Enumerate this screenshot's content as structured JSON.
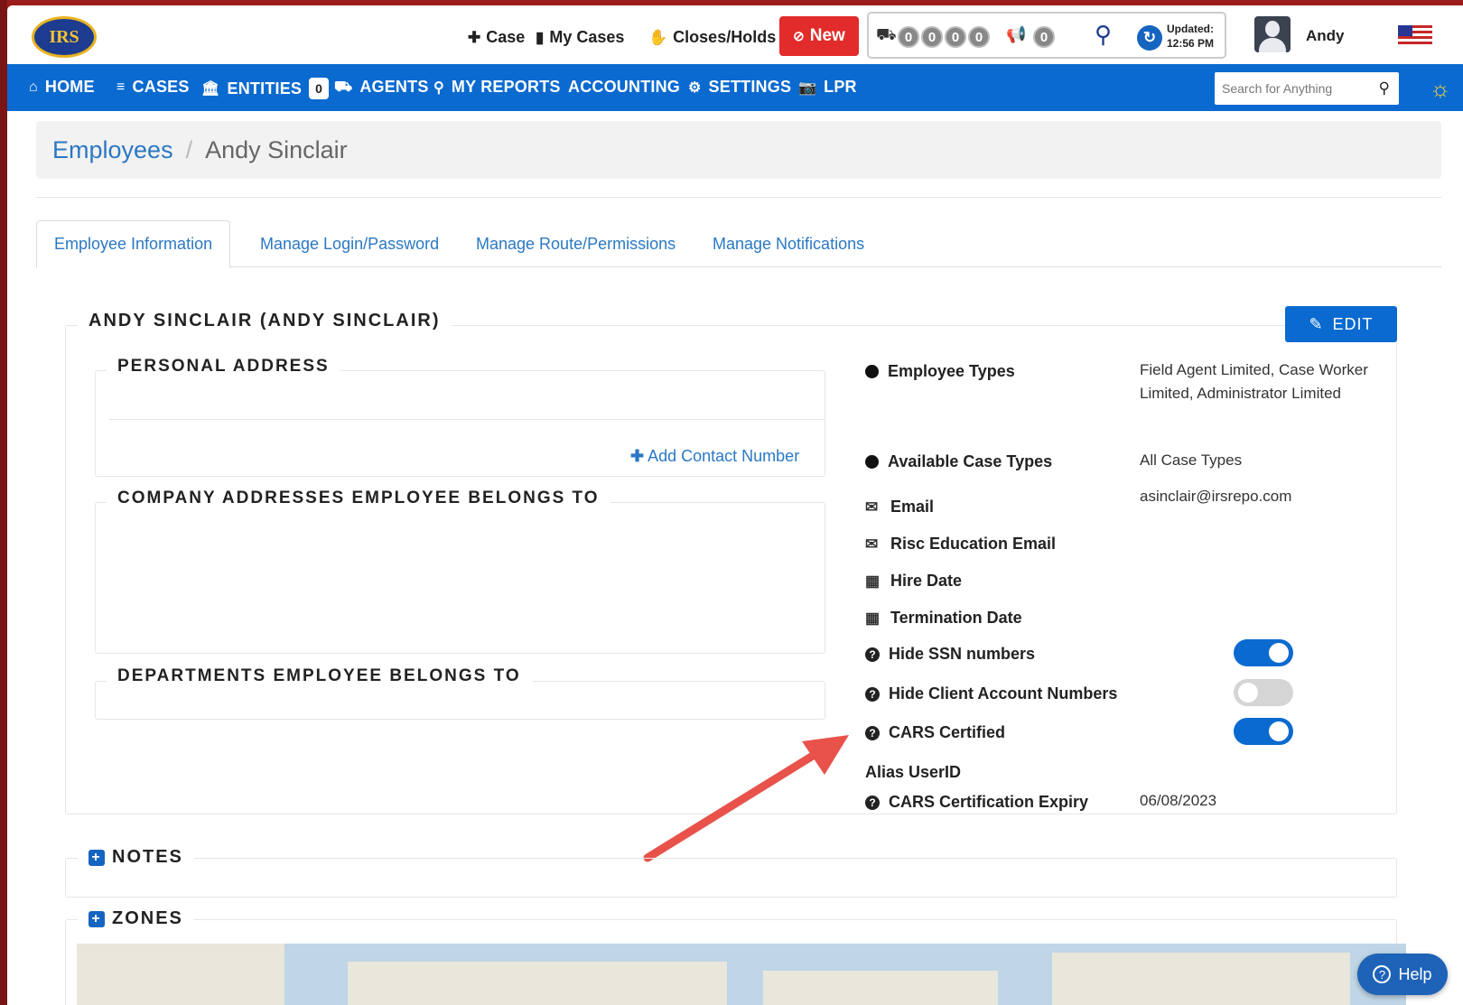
{
  "header": {
    "logo_text": "IRS",
    "case_label": "Case",
    "my_cases_label": "My Cases",
    "closes_holds_label": "Closes/Holds",
    "new_label": "New",
    "counters": [
      "0",
      "0",
      "0",
      "0"
    ],
    "megaphone_count": "0",
    "updated_label": "Updated:",
    "updated_time": "12:56 PM",
    "username": "Andy"
  },
  "nav": {
    "home": "HOME",
    "cases": "CASES",
    "entities": "ENTITIES",
    "entities_badge": "0",
    "agents": "AGENTS",
    "my_reports": "MY REPORTS",
    "accounting": "ACCOUNTING",
    "settings": "SETTINGS",
    "lpr": "LPR",
    "search_placeholder": "Search for Anything"
  },
  "breadcrumb": {
    "parent": "Employees",
    "separator": "/",
    "current": "Andy Sinclair"
  },
  "tabs": [
    {
      "label": "Employee Information",
      "active": true
    },
    {
      "label": "Manage Login/Password",
      "active": false
    },
    {
      "label": "Manage Route/Permissions",
      "active": false
    },
    {
      "label": "Manage Notifications",
      "active": false
    }
  ],
  "employee": {
    "title": "ANDY SINCLAIR (ANDY SINCLAIR)",
    "edit_label": "EDIT",
    "personal_address_title": "PERSONAL ADDRESS",
    "add_contact_label": "Add Contact Number",
    "company_addresses_title": "COMPANY ADDRESSES EMPLOYEE BELONGS TO",
    "departments_title": "DEPARTMENTS EMPLOYEE BELONGS TO"
  },
  "info": {
    "employee_types_label": "Employee Types",
    "employee_types_value": "Field Agent Limited, Case Worker Limited, Administrator Limited",
    "available_case_types_label": "Available Case Types",
    "available_case_types_value": "All Case Types",
    "email_label": "Email",
    "email_value": "asinclair@irsrepo.com",
    "risc_email_label": "Risc Education Email",
    "hire_date_label": "Hire Date",
    "termination_date_label": "Termination Date",
    "hide_ssn_label": "Hide SSN numbers",
    "hide_ssn_on": true,
    "hide_client_label": "Hide Client Account Numbers",
    "hide_client_on": false,
    "cars_certified_label": "CARS Certified",
    "cars_certified_on": true,
    "alias_userid_label": "Alias UserID",
    "cars_expiry_label": "CARS Certification Expiry",
    "cars_expiry_value": "06/08/2023"
  },
  "sections": {
    "notes_title": "NOTES",
    "zones_title": "ZONES"
  },
  "help_label": "Help",
  "colors": {
    "nav_blue": "#0a6ad0",
    "new_red": "#e22b2b",
    "link_blue": "#2b78c4",
    "arrow_red": "#e8524a"
  }
}
